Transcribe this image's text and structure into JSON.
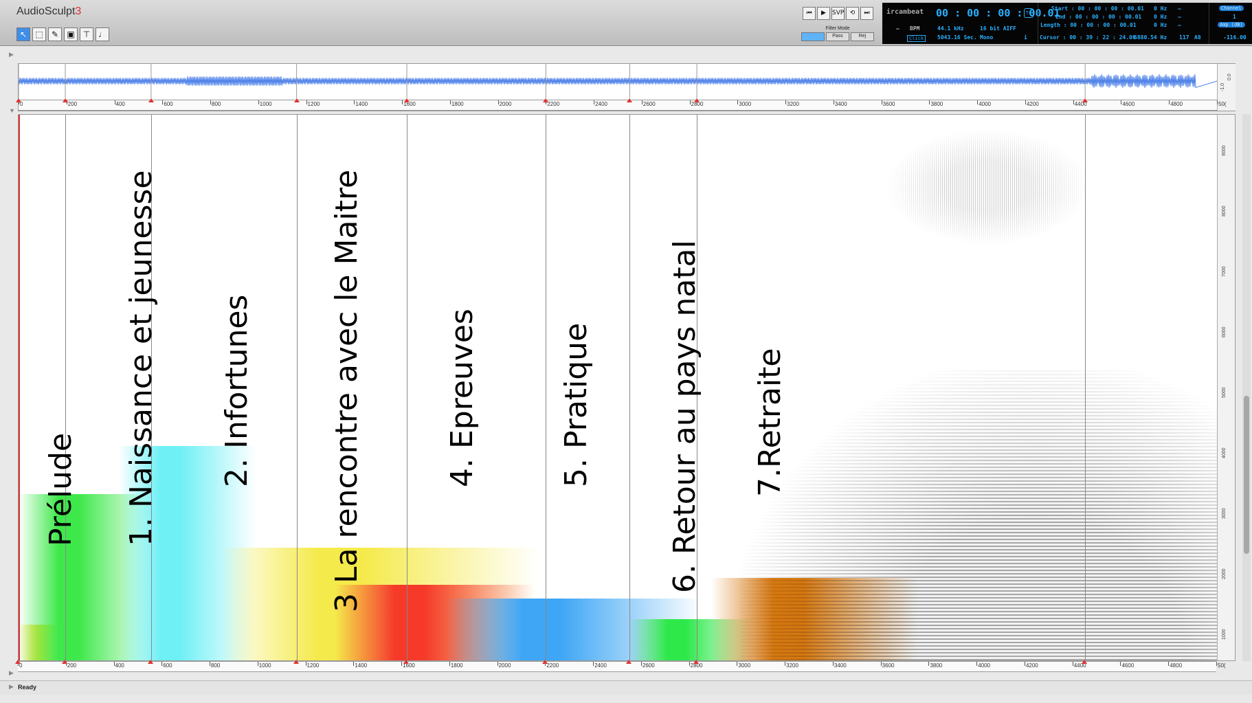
{
  "app": {
    "name": "AudioSculpt",
    "version": "3"
  },
  "toolbar": {
    "tools": [
      {
        "icon": "arrow-pointer-icon",
        "glyph": "↖"
      },
      {
        "icon": "marquee-select-icon",
        "glyph": "⬚"
      },
      {
        "icon": "pencil-icon",
        "glyph": "✎"
      },
      {
        "icon": "rectangle-tool-icon",
        "glyph": "▣"
      },
      {
        "icon": "filter-tool-icon",
        "glyph": "⊤"
      },
      {
        "icon": "note-tool-icon",
        "glyph": "♩"
      }
    ]
  },
  "transport": {
    "buttons": [
      {
        "icon": "skip-back-icon",
        "glyph": "⏮"
      },
      {
        "icon": "play-icon",
        "glyph": "▶"
      },
      {
        "icon": "svp-play-icon",
        "glyph": "SVP"
      },
      {
        "icon": "loop-icon",
        "glyph": "⟲"
      },
      {
        "icon": "skip-forward-icon",
        "glyph": "⏭"
      }
    ],
    "filter_mode_label": "Filter Mode",
    "filter_buttons": [
      "Gain",
      "Pass",
      "Rej"
    ]
  },
  "lcd": {
    "brand": "ircambeat",
    "time": "00 : 00 : 00 : 00.01",
    "tc": "TC",
    "bpm_label": "BPM",
    "dash": "–",
    "samplerate": "44.1 kHz",
    "bitdepth": "16 bit AIFF",
    "duration": "5043.16 Sec.",
    "channels_mode": "Mono",
    "click": "Click",
    "info": "i",
    "start": "Start : 00 : 00 : 00 : 00.01",
    "end": "End : 00 : 00 : 00 : 00.01",
    "length": "Length : 00 : 00 : 00 : 00.01",
    "cursor": "Cursor : 00 : 39 : 22 : 24.06",
    "hz1": "0 Hz",
    "hz2": "0 Hz",
    "hz3": "0 Hz",
    "cursor_hz": "6880.54 Hz",
    "n117": "117",
    "note": "A8",
    "channel_label": "Channel",
    "channel_value": "1",
    "amp_label": "Amp (dB)",
    "amp_value": "-116.00"
  },
  "overview_scale": [
    "-1.0",
    "0.0"
  ],
  "time_ticks": [
    "0",
    "200",
    "400",
    "600",
    "800",
    "1000",
    "1200",
    "1400",
    "1600",
    "1800",
    "2000",
    "2200",
    "2400",
    "2600",
    "2800",
    "3000",
    "3200",
    "3400",
    "3600",
    "3800",
    "4000",
    "4200",
    "4400",
    "4600",
    "4800",
    "50("
  ],
  "freq_ticks": [
    "9000",
    "8000",
    "7000",
    "6000",
    "5000",
    "4000",
    "3000",
    "2000",
    "1000"
  ],
  "markers_sec": [
    0,
    195,
    553,
    1160,
    1620,
    2200,
    2550,
    2830,
    4450
  ],
  "sections": [
    {
      "label": "Prélude"
    },
    {
      "label": "1. Naissance et jeunesse"
    },
    {
      "label": "2. Infortunes"
    },
    {
      "label": "3 La rencontre avec le Maitre"
    },
    {
      "label": "4. Epreuves"
    },
    {
      "label": "5. Pratique"
    },
    {
      "label": "6. Retour au pays natal"
    },
    {
      "label": "7.Retraite"
    }
  ],
  "band_colors": [
    "#f5e23a",
    "#3ee84a",
    "#6ff0f5",
    "#f5ea4c",
    "#f53a2a",
    "#3ea6f5",
    "#2ee84a",
    "#d97a12"
  ],
  "status": "Ready"
}
